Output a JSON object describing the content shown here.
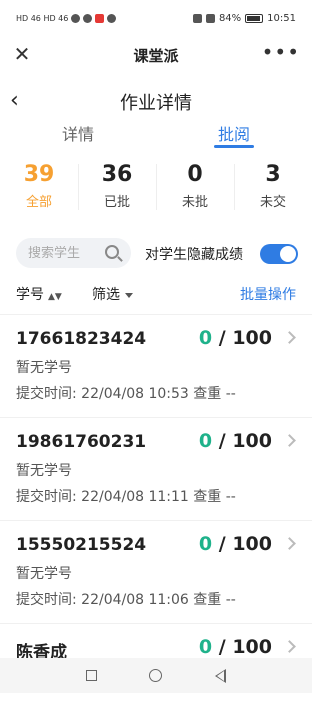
{
  "status_bar": {
    "carrier_left": "HD 46 HD 46",
    "battery": "84%",
    "time": "10:51"
  },
  "app": {
    "title": "课堂派",
    "close_icon": "close-icon",
    "more_icon": "more-icon"
  },
  "page": {
    "title": "作业详情",
    "back_icon": "chevron-left-icon"
  },
  "tabs": [
    {
      "label": "详情",
      "active": false
    },
    {
      "label": "批阅",
      "active": true
    }
  ],
  "stats": [
    {
      "value": "39",
      "label": "全部",
      "highlight": true
    },
    {
      "value": "36",
      "label": "已批",
      "highlight": false
    },
    {
      "value": "0",
      "label": "未批",
      "highlight": false
    },
    {
      "value": "3",
      "label": "未交",
      "highlight": false
    }
  ],
  "search": {
    "placeholder": "搜索学生",
    "icon": "search-icon"
  },
  "hide_scores": {
    "label": "对学生隐藏成绩",
    "enabled": true,
    "accent": "#2f7ce3"
  },
  "toolbar": {
    "sort_label": "学号",
    "sort_arrows": "▲▼",
    "filter_label": "筛选",
    "batch_label": "批量操作"
  },
  "students": [
    {
      "name": "17661823424",
      "score": "0",
      "total": " / 100",
      "sub": "暂无学号",
      "meta": "提交时间:  22/04/08 10:53  查重  --"
    },
    {
      "name": "19861760231",
      "score": "0",
      "total": " / 100",
      "sub": "暂无学号",
      "meta": "提交时间:  22/04/08 11:11  查重  --"
    },
    {
      "name": "15550215524",
      "score": "0",
      "total": " / 100",
      "sub": "暂无学号",
      "meta": "提交时间:  22/04/08 11:06  查重  --"
    },
    {
      "name": "陈香成",
      "score": "0",
      "total": " / 100",
      "sub": "",
      "meta": ""
    }
  ],
  "colors": {
    "accent": "#2f7ce3",
    "highlight": "#f6a031",
    "score": "#1fb28b"
  }
}
